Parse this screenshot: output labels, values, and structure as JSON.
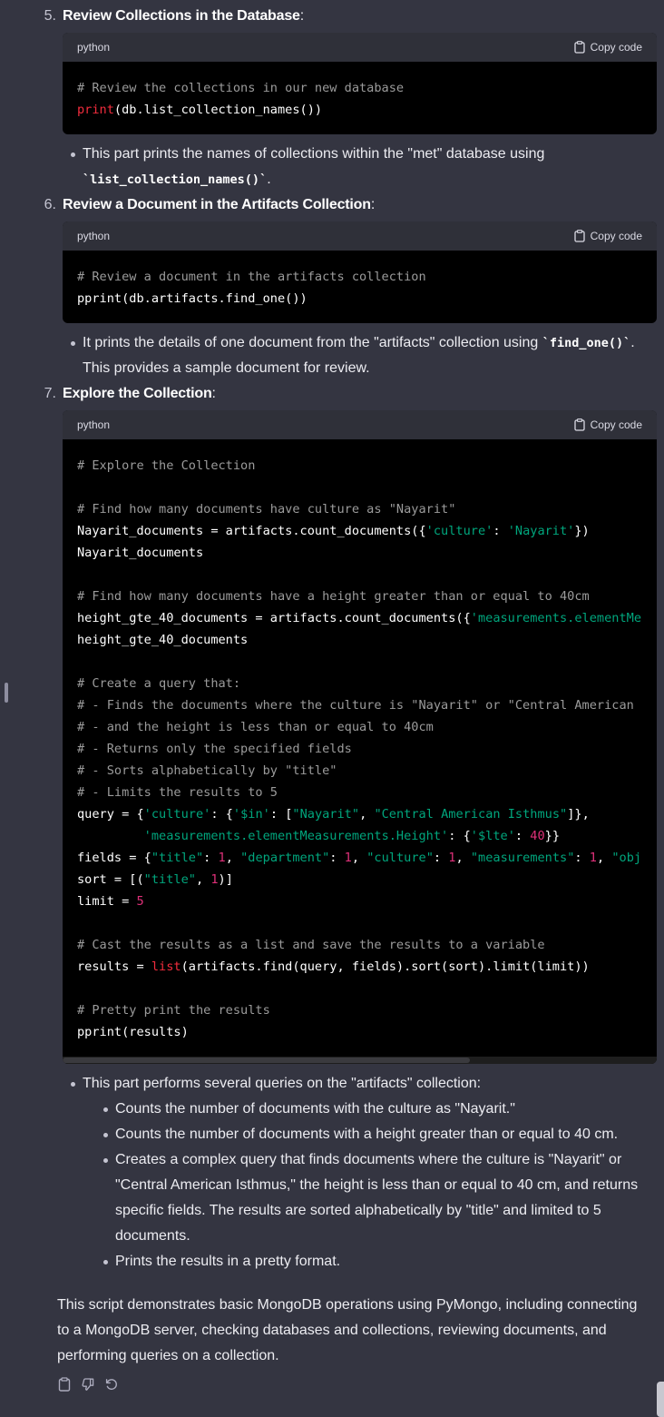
{
  "steps": [
    {
      "number": "5.",
      "title": "Review Collections in the Database",
      "colon": ":",
      "code_lang": "python",
      "copy_label": "Copy code",
      "bullet_prefix": "This part prints the names of collections within the \"met\" database using",
      "bullet_code": "`list_collection_names()`",
      "bullet_suffix": "."
    },
    {
      "number": "6.",
      "title": "Review a Document in the Artifacts Collection",
      "colon": ":",
      "code_lang": "python",
      "copy_label": "Copy code",
      "bullet_prefix": "It prints the details of one document from the \"artifacts\" collection using",
      "bullet_code": "`find_one()`",
      "bullet_suffix": ".",
      "bullet_line2": "This provides a sample document for review."
    },
    {
      "number": "7.",
      "title": "Explore the Collection",
      "colon": ":",
      "code_lang": "python",
      "copy_label": "Copy code",
      "bullet": "This part performs several queries on the \"artifacts\" collection:",
      "sub_bullets": [
        "Counts the number of documents with the culture as \"Nayarit.\"",
        "Counts the number of documents with a height greater than or equal to 40 cm.",
        "Creates a complex query that finds documents where the culture is \"Nayarit\" or",
        "\"Central American Isthmus,\" the height is less than or equal to 40 cm, and returns",
        "specific fields. The results are sorted alphabetically by \"title\" and limited to 5",
        "documents.",
        "Prints the results in a pretty format."
      ]
    }
  ],
  "code_5": [
    [
      {
        "t": "c",
        "v": "# Review the collections in our new database"
      }
    ],
    [
      {
        "t": "f",
        "v": "print"
      },
      {
        "t": "p",
        "v": "(db.list_collection_names())"
      }
    ]
  ],
  "code_6": [
    [
      {
        "t": "c",
        "v": "# Review a document in the artifacts collection"
      }
    ],
    [
      {
        "t": "p",
        "v": "pprint(db.artifacts.find_one())"
      }
    ]
  ],
  "code_7": [
    [
      {
        "t": "c",
        "v": "# Explore the Collection"
      }
    ],
    [],
    [
      {
        "t": "c",
        "v": "# Find how many documents have culture as \"Nayarit\""
      }
    ],
    [
      {
        "t": "p",
        "v": "Nayarit_documents = artifacts.count_documents({"
      },
      {
        "t": "s",
        "v": "'culture'"
      },
      {
        "t": "p",
        "v": ": "
      },
      {
        "t": "s",
        "v": "'Nayarit'"
      },
      {
        "t": "p",
        "v": "})"
      }
    ],
    [
      {
        "t": "p",
        "v": "Nayarit_documents"
      }
    ],
    [],
    [
      {
        "t": "c",
        "v": "# Find how many documents have a height greater than or equal to 40cm"
      }
    ],
    [
      {
        "t": "p",
        "v": "height_gte_40_documents = artifacts.count_documents({"
      },
      {
        "t": "s",
        "v": "'measurements.elementMe"
      }
    ],
    [
      {
        "t": "p",
        "v": "height_gte_40_documents"
      }
    ],
    [],
    [
      {
        "t": "c",
        "v": "# Create a query that:"
      }
    ],
    [
      {
        "t": "c",
        "v": "# - Finds the documents where the culture is \"Nayarit\" or \"Central American"
      }
    ],
    [
      {
        "t": "c",
        "v": "# - and the height is less than or equal to 40cm"
      }
    ],
    [
      {
        "t": "c",
        "v": "# - Returns only the specified fields"
      }
    ],
    [
      {
        "t": "c",
        "v": "# - Sorts alphabetically by \"title\""
      }
    ],
    [
      {
        "t": "c",
        "v": "# - Limits the results to 5"
      }
    ],
    [
      {
        "t": "p",
        "v": "query = {"
      },
      {
        "t": "s",
        "v": "'culture'"
      },
      {
        "t": "p",
        "v": ": {"
      },
      {
        "t": "s",
        "v": "'$in'"
      },
      {
        "t": "p",
        "v": ": ["
      },
      {
        "t": "s",
        "v": "\"Nayarit\""
      },
      {
        "t": "p",
        "v": ", "
      },
      {
        "t": "s",
        "v": "\"Central American Isthmus\""
      },
      {
        "t": "p",
        "v": "]},"
      }
    ],
    [
      {
        "t": "p",
        "v": "         "
      },
      {
        "t": "s",
        "v": "'measurements.elementMeasurements.Height'"
      },
      {
        "t": "p",
        "v": ": {"
      },
      {
        "t": "s",
        "v": "'$lte'"
      },
      {
        "t": "p",
        "v": ": "
      },
      {
        "t": "n",
        "v": "40"
      },
      {
        "t": "p",
        "v": "}}"
      }
    ],
    [
      {
        "t": "p",
        "v": "fields = {"
      },
      {
        "t": "s",
        "v": "\"title\""
      },
      {
        "t": "p",
        "v": ": "
      },
      {
        "t": "n",
        "v": "1"
      },
      {
        "t": "p",
        "v": ", "
      },
      {
        "t": "s",
        "v": "\"department\""
      },
      {
        "t": "p",
        "v": ": "
      },
      {
        "t": "n",
        "v": "1"
      },
      {
        "t": "p",
        "v": ", "
      },
      {
        "t": "s",
        "v": "\"culture\""
      },
      {
        "t": "p",
        "v": ": "
      },
      {
        "t": "n",
        "v": "1"
      },
      {
        "t": "p",
        "v": ", "
      },
      {
        "t": "s",
        "v": "\"measurements\""
      },
      {
        "t": "p",
        "v": ": "
      },
      {
        "t": "n",
        "v": "1"
      },
      {
        "t": "p",
        "v": ", "
      },
      {
        "t": "s",
        "v": "\"obj"
      }
    ],
    [
      {
        "t": "p",
        "v": "sort = [("
      },
      {
        "t": "s",
        "v": "\"title\""
      },
      {
        "t": "p",
        "v": ", "
      },
      {
        "t": "n",
        "v": "1"
      },
      {
        "t": "p",
        "v": ")]"
      }
    ],
    [
      {
        "t": "p",
        "v": "limit = "
      },
      {
        "t": "n",
        "v": "5"
      }
    ],
    [],
    [
      {
        "t": "c",
        "v": "# Cast the results as a list and save the results to a variable"
      }
    ],
    [
      {
        "t": "p",
        "v": "results = "
      },
      {
        "t": "f",
        "v": "list"
      },
      {
        "t": "p",
        "v": "(artifacts.find(query, fields).sort(sort).limit(limit))"
      }
    ],
    [],
    [
      {
        "t": "c",
        "v": "# Pretty print the results"
      }
    ],
    [
      {
        "t": "p",
        "v": "pprint(results)"
      }
    ]
  ],
  "summary_lines": [
    "This script demonstrates basic MongoDB operations using PyMongo, including connecting",
    "to a MongoDB server, checking databases and collections, reviewing documents, and",
    "performing queries on a collection."
  ],
  "actions": [
    "clipboard-icon",
    "thumbs-down-icon",
    "regenerate-icon"
  ],
  "colors": {
    "background": "#343541",
    "code_background": "#000000",
    "comment": "#9b9b9b",
    "string": "#00a67d",
    "number": "#df3079",
    "builtin": "#f22c3d"
  }
}
